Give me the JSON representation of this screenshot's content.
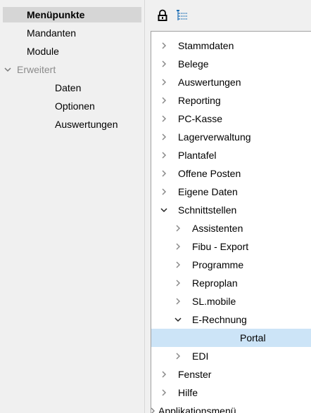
{
  "sidebar": {
    "items": [
      {
        "label": "Menüpunkte"
      },
      {
        "label": "Mandanten"
      },
      {
        "label": "Module"
      },
      {
        "label": "Erweitert"
      },
      {
        "label": "Daten"
      },
      {
        "label": "Optionen"
      },
      {
        "label": "Auswertungen"
      }
    ]
  },
  "toolbar": {
    "lock_icon": "lock-icon",
    "tree_icon": "tree-structure-icon"
  },
  "tree": {
    "nodes": [
      {
        "label": "Stammdaten",
        "state": "collapsed"
      },
      {
        "label": "Belege",
        "state": "collapsed"
      },
      {
        "label": "Auswertungen",
        "state": "collapsed"
      },
      {
        "label": "Reporting",
        "state": "collapsed"
      },
      {
        "label": "PC-Kasse",
        "state": "collapsed"
      },
      {
        "label": "Lagerverwaltung",
        "state": "collapsed"
      },
      {
        "label": "Plantafel",
        "state": "collapsed"
      },
      {
        "label": "Offene Posten",
        "state": "collapsed"
      },
      {
        "label": "Eigene Daten",
        "state": "collapsed"
      },
      {
        "label": "Schnittstellen",
        "state": "expanded"
      },
      {
        "label": "Assistenten",
        "state": "collapsed"
      },
      {
        "label": "Fibu - Export",
        "state": "collapsed"
      },
      {
        "label": "Programme",
        "state": "collapsed"
      },
      {
        "label": "Reproplan",
        "state": "collapsed"
      },
      {
        "label": "SL.mobile",
        "state": "collapsed"
      },
      {
        "label": "E-Rechnung",
        "state": "expanded"
      },
      {
        "label": "Portal",
        "state": "leaf",
        "selected": true
      },
      {
        "label": "EDI",
        "state": "collapsed"
      },
      {
        "label": "Fenster",
        "state": "collapsed"
      },
      {
        "label": "Hilfe",
        "state": "collapsed"
      },
      {
        "label": "Applikationsmenü",
        "state": "collapsed"
      }
    ]
  },
  "colors": {
    "selection": "#cce4f7",
    "sidebar_selection": "#d6d6d6",
    "disabled_text": "#8b8b8b",
    "arrow": "#8a8a8a"
  }
}
